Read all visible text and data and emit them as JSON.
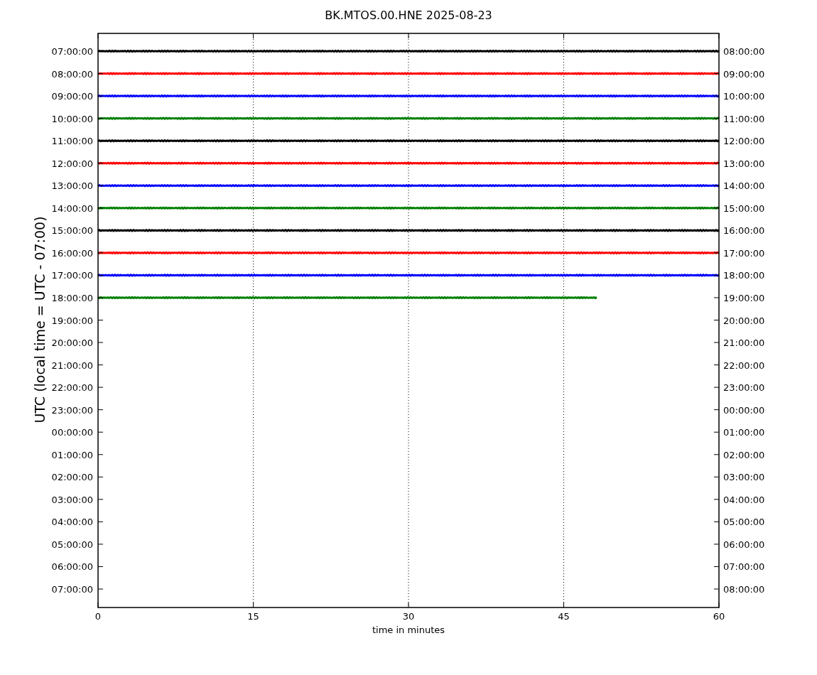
{
  "figure": {
    "title": "BK.MTOS.00.HNE 2025-08-23",
    "ylabel": "UTC (local time = UTC - 07:00)",
    "xlabel": "time in minutes",
    "x_tick_labels": [
      "0",
      "15",
      "30",
      "45",
      "60"
    ],
    "left_tick_labels": [
      "07:00:00",
      "08:00:00",
      "09:00:00",
      "10:00:00",
      "11:00:00",
      "12:00:00",
      "13:00:00",
      "14:00:00",
      "15:00:00",
      "16:00:00",
      "17:00:00",
      "18:00:00",
      "19:00:00",
      "20:00:00",
      "21:00:00",
      "22:00:00",
      "23:00:00",
      "00:00:00",
      "01:00:00",
      "02:00:00",
      "03:00:00",
      "04:00:00",
      "05:00:00",
      "06:00:00",
      "07:00:00"
    ],
    "right_tick_labels": [
      "08:00:00",
      "09:00:00",
      "10:00:00",
      "11:00:00",
      "12:00:00",
      "13:00:00",
      "14:00:00",
      "15:00:00",
      "16:00:00",
      "17:00:00",
      "18:00:00",
      "19:00:00",
      "20:00:00",
      "21:00:00",
      "22:00:00",
      "23:00:00",
      "00:00:00",
      "01:00:00",
      "02:00:00",
      "03:00:00",
      "04:00:00",
      "05:00:00",
      "06:00:00",
      "07:00:00",
      "08:00:00"
    ],
    "traces": [
      {
        "color": "#000000",
        "level": 1
      },
      {
        "color": "#ff0000",
        "level": 1
      },
      {
        "color": "#0000ff",
        "level": 1
      },
      {
        "color": "#008000",
        "level": 1
      },
      {
        "color": "#000000",
        "level": 1
      },
      {
        "color": "#ff0000",
        "level": 1
      },
      {
        "color": "#0000ff",
        "level": 1
      },
      {
        "color": "#008000",
        "level": 1
      },
      {
        "color": "#000000",
        "level": 1
      },
      {
        "color": "#ff0000",
        "level": 1
      },
      {
        "color": "#0000ff",
        "level": 1
      },
      {
        "color": "#008000",
        "level": 0.805
      }
    ]
  }
}
